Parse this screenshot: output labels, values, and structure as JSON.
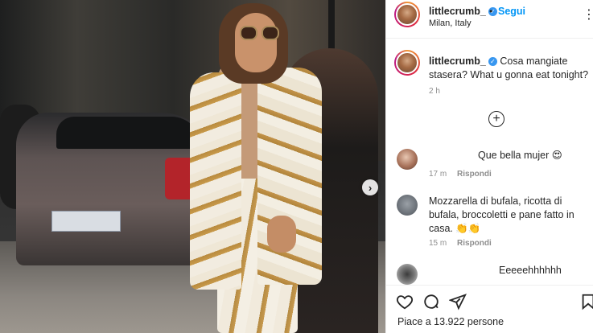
{
  "post": {
    "username": "littlecrumb_",
    "follow_label": "Segui",
    "separator": "•",
    "location": "Milan, Italy",
    "more_icon": "more-horizontal-icon"
  },
  "caption": {
    "username": "littlecrumb_",
    "text": "Cosa mangiate stasera? What u gonna eat tonight?",
    "time": "2 h"
  },
  "comments": [
    {
      "text": "Que bella mujer 😍",
      "time": "17 m",
      "reply_label": "Rispondi"
    },
    {
      "text": "Mozzarella di bufala, ricotta di bufala, broccoletti e pane fatto in casa. 👏👏",
      "time": "15 m",
      "reply_label": "Rispondi"
    },
    {
      "text": "Eeeeehhhhhh"
    }
  ],
  "likes": {
    "text": "Piace a 13.922 persone"
  },
  "colors": {
    "accent": "#0095f6",
    "verified": "#3897f0",
    "muted": "#8e8e8e",
    "text": "#262626"
  }
}
